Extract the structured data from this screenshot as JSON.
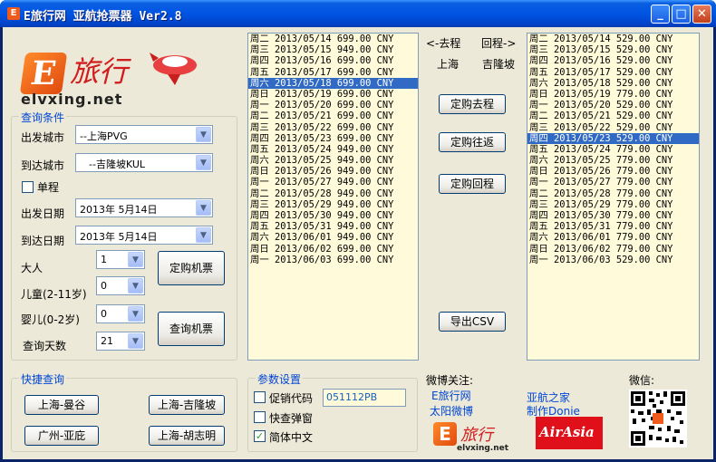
{
  "window": {
    "icon_letter": "E",
    "title": "E旅行网  亚航抢票器 Ver2.8",
    "minimize": "_",
    "maximize": "□",
    "close": "✕"
  },
  "logo": {
    "brand_cn": "旅行",
    "brand_en": "elvxing.net",
    "letter": "E"
  },
  "query": {
    "group_title": "查询条件",
    "depart_city_label": "出发城市",
    "depart_city_value": "--上海PVG",
    "arrive_city_label": "到达城市",
    "arrive_city_value": "--吉隆坡KUL",
    "one_way_label": "单程",
    "depart_date_label": "出发日期",
    "depart_date_value": "2013年 5月14日",
    "return_date_label": "到达日期",
    "return_date_value": "2013年 5月14日",
    "adult_label": "大人",
    "adult_value": "1",
    "child_label": "儿童(2-11岁)",
    "child_value": "0",
    "infant_label": "婴儿(0-2岁)",
    "infant_value": "0",
    "days_label": "查询天数",
    "days_value": "21",
    "book_button": "定购机票",
    "search_button": "查询机票"
  },
  "quick": {
    "group_title": "快捷查询",
    "buttons": [
      "上海-曼谷",
      "上海-吉隆坡",
      "广州-亚庇",
      "上海-胡志明"
    ]
  },
  "settings": {
    "group_title": "参数设置",
    "promo_label": "促销代码",
    "promo_value": "051112PB",
    "quick_popup_label": "快查弹窗",
    "simplified_label": "简体中文",
    "simplified_checked": "✓"
  },
  "middle": {
    "outbound_header": "<-去程",
    "return_header": "回程->",
    "outbound_city": "上海",
    "return_city": "吉隆坡",
    "book_outbound": "定购去程",
    "book_roundtrip": "定购往返",
    "book_return": "定购回程",
    "export_csv": "导出CSV"
  },
  "outbound_list": {
    "selected_index": 4,
    "rows": [
      "周二 2013/05/14 699.00 CNY",
      "周三 2013/05/15 949.00 CNY",
      "周四 2013/05/16 699.00 CNY",
      "周五 2013/05/17 699.00 CNY",
      "周六 2013/05/18 699.00 CNY",
      "周日 2013/05/19 699.00 CNY",
      "周一 2013/05/20 699.00 CNY",
      "周二 2013/05/21 699.00 CNY",
      "周三 2013/05/22 699.00 CNY",
      "周四 2013/05/23 699.00 CNY",
      "周五 2013/05/24 949.00 CNY",
      "周六 2013/05/25 949.00 CNY",
      "周日 2013/05/26 949.00 CNY",
      "周一 2013/05/27 949.00 CNY",
      "周二 2013/05/28 949.00 CNY",
      "周三 2013/05/29 949.00 CNY",
      "周四 2013/05/30 949.00 CNY",
      "周五 2013/05/31 949.00 CNY",
      "周六 2013/06/01 949.00 CNY",
      "周日 2013/06/02 699.00 CNY",
      "周一 2013/06/03 699.00 CNY"
    ]
  },
  "return_list": {
    "selected_index": 9,
    "rows": [
      "周二 2013/05/14 529.00 CNY",
      "周三 2013/05/15 529.00 CNY",
      "周四 2013/05/16 529.00 CNY",
      "周五 2013/05/17 529.00 CNY",
      "周六 2013/05/18 529.00 CNY",
      "周日 2013/05/19 779.00 CNY",
      "周一 2013/05/20 529.00 CNY",
      "周二 2013/05/21 529.00 CNY",
      "周三 2013/05/22 529.00 CNY",
      "周四 2013/05/23 529.00 CNY",
      "周五 2013/05/24 779.00 CNY",
      "周六 2013/05/25 779.00 CNY",
      "周日 2013/05/26 779.00 CNY",
      "周一 2013/05/27 779.00 CNY",
      "周二 2013/05/28 779.00 CNY",
      "周三 2013/05/29 779.00 CNY",
      "周四 2013/05/30 779.00 CNY",
      "周五 2013/05/31 779.00 CNY",
      "周六 2013/06/01 779.00 CNY",
      "周日 2013/06/02 779.00 CNY",
      "周一 2013/06/03 529.00 CNY"
    ]
  },
  "weibo": {
    "follow_label": "微博关注:",
    "link1": "E旅行网",
    "link2": "太阳微博",
    "link3": "亚航之家",
    "credit": "制作Donie",
    "wechat_label": "微信:",
    "airasia_logo": "AirAsia",
    "footer_brand_en": "elvxing.net",
    "footer_brand_cn": "旅行"
  },
  "colors": {
    "titlebar": "#0054e3",
    "list_bg": "#fffbda",
    "selection": "#316ac5",
    "group_title": "#0046d5",
    "brand_orange": "#f05a1a",
    "airasia_red": "#e0101a"
  }
}
